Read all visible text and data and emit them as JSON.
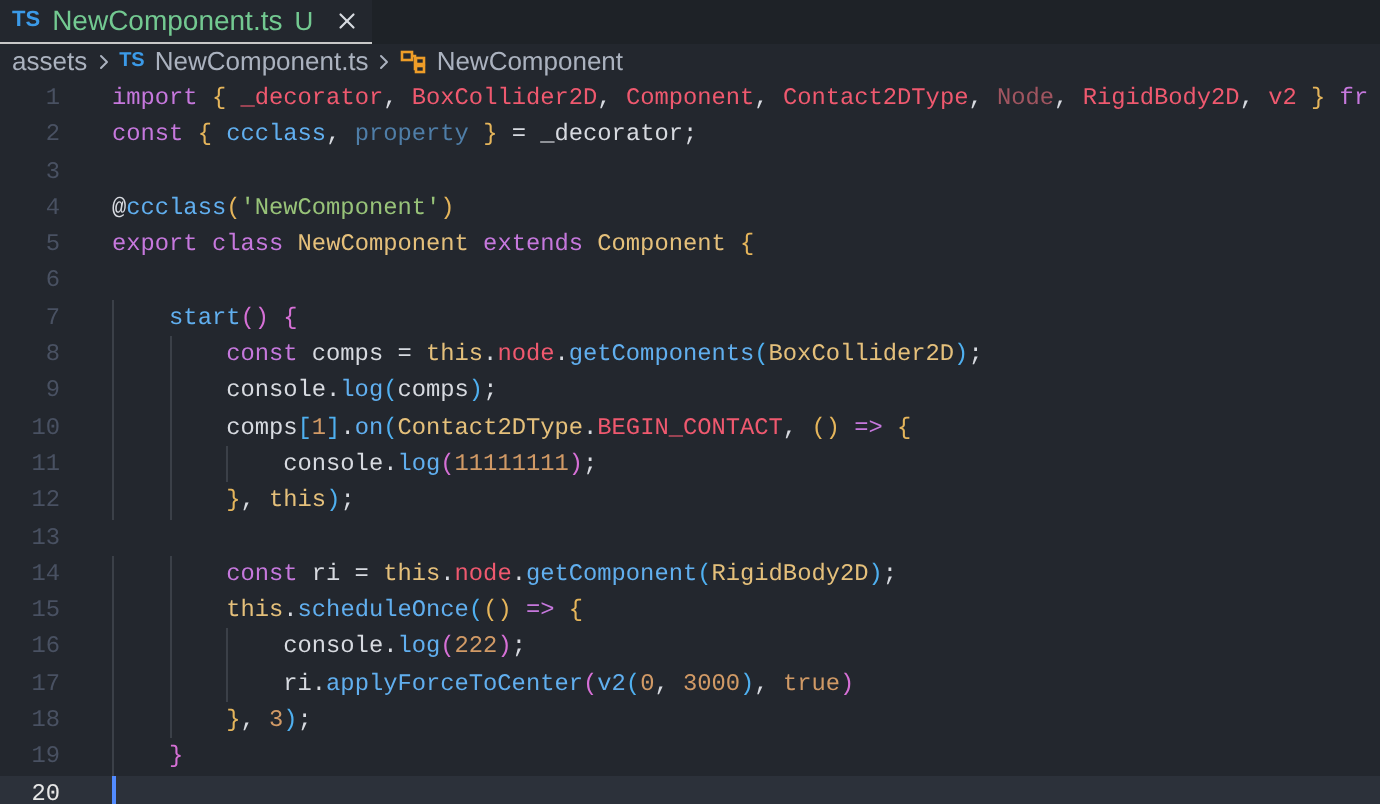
{
  "tabs": [
    {
      "icon_text": "TS",
      "label": "NewComponent.ts",
      "status": "U",
      "selected": true
    }
  ],
  "breadcrumb": {
    "folder": "assets",
    "file_icon_text": "TS",
    "file": "NewComponent.ts",
    "symbol": "NewComponent"
  },
  "lines": [
    {
      "number": "1",
      "active": false,
      "tokens": [
        {
          "kind": "keyword",
          "text": "import"
        },
        {
          "kind": "bracket1",
          "text": " {"
        },
        {
          "kind": "type",
          "text": " _decorator"
        },
        {
          "kind": "plain",
          "text": ", "
        },
        {
          "kind": "type",
          "text": "BoxCollider2D"
        },
        {
          "kind": "plain",
          "text": ", "
        },
        {
          "kind": "type",
          "text": "Component"
        },
        {
          "kind": "plain",
          "text": ", "
        },
        {
          "kind": "type",
          "text": "Contact2DType"
        },
        {
          "kind": "plain",
          "text": ", "
        },
        {
          "kind": "faded_type",
          "text": "Node"
        },
        {
          "kind": "plain",
          "text": ", "
        },
        {
          "kind": "type",
          "text": "RigidBody2D"
        },
        {
          "kind": "plain",
          "text": ", "
        },
        {
          "kind": "type",
          "text": "v2"
        },
        {
          "kind": "bracket1",
          "text": " }"
        },
        {
          "kind": "keyword",
          "text": " fr"
        }
      ]
    },
    {
      "number": "2",
      "active": false,
      "tokens": [
        {
          "kind": "keyword",
          "text": "const"
        },
        {
          "kind": "bracket1",
          "text": " {"
        },
        {
          "kind": "function",
          "text": " ccclass"
        },
        {
          "kind": "plain",
          "text": ", "
        },
        {
          "kind": "faded_function",
          "text": "property"
        },
        {
          "kind": "bracket1",
          "text": " }"
        },
        {
          "kind": "plain",
          "text": " = _decorator;"
        }
      ]
    },
    {
      "number": "3",
      "active": false
    },
    {
      "number": "4",
      "active": false,
      "tokens": [
        {
          "kind": "plain",
          "text": "@"
        },
        {
          "kind": "function",
          "text": "ccclass"
        },
        {
          "kind": "bracket1",
          "text": "("
        },
        {
          "kind": "string",
          "text": "'NewComponent'"
        },
        {
          "kind": "bracket1",
          "text": ")"
        }
      ]
    },
    {
      "number": "5",
      "active": false,
      "tokens": [
        {
          "kind": "keyword",
          "text": "export"
        },
        {
          "kind": "keyword",
          "text": " class"
        },
        {
          "kind": "class",
          "text": " NewComponent"
        },
        {
          "kind": "keyword",
          "text": " extends"
        },
        {
          "kind": "class",
          "text": " Component"
        },
        {
          "kind": "bracket1",
          "text": " {"
        }
      ]
    },
    {
      "number": "6",
      "active": false
    },
    {
      "number": "7",
      "active": false,
      "tokens": [
        {
          "kind": "function",
          "text": "    start"
        },
        {
          "kind": "bracket2",
          "text": "()"
        },
        {
          "kind": "bracket2",
          "text": " {"
        }
      ]
    },
    {
      "number": "8",
      "active": false,
      "tokens": [
        {
          "kind": "keyword",
          "text": "        const"
        },
        {
          "kind": "plain",
          "text": " comps = "
        },
        {
          "kind": "class",
          "text": "this"
        },
        {
          "kind": "plain",
          "text": "."
        },
        {
          "kind": "type",
          "text": "node"
        },
        {
          "kind": "plain",
          "text": "."
        },
        {
          "kind": "function",
          "text": "getComponents"
        },
        {
          "kind": "bracket3",
          "text": "("
        },
        {
          "kind": "class",
          "text": "BoxCollider2D"
        },
        {
          "kind": "bracket3",
          "text": ")"
        },
        {
          "kind": "plain",
          "text": ";"
        }
      ]
    },
    {
      "number": "9",
      "active": false,
      "tokens": [
        {
          "kind": "plain",
          "text": "        console."
        },
        {
          "kind": "function",
          "text": "log"
        },
        {
          "kind": "bracket3",
          "text": "("
        },
        {
          "kind": "plain",
          "text": "comps"
        },
        {
          "kind": "bracket3",
          "text": ")"
        },
        {
          "kind": "plain",
          "text": ";"
        }
      ]
    },
    {
      "number": "10",
      "active": false,
      "tokens": [
        {
          "kind": "plain",
          "text": "        comps"
        },
        {
          "kind": "bracket3",
          "text": "["
        },
        {
          "kind": "number",
          "text": "1"
        },
        {
          "kind": "bracket3",
          "text": "]"
        },
        {
          "kind": "plain",
          "text": "."
        },
        {
          "kind": "function",
          "text": "on"
        },
        {
          "kind": "bracket3",
          "text": "("
        },
        {
          "kind": "class",
          "text": "Contact2DType"
        },
        {
          "kind": "plain",
          "text": "."
        },
        {
          "kind": "type",
          "text": "BEGIN_CONTACT"
        },
        {
          "kind": "plain",
          "text": ", "
        },
        {
          "kind": "bracket1",
          "text": "()"
        },
        {
          "kind": "keyword",
          "text": " =>"
        },
        {
          "kind": "bracket1",
          "text": " {"
        }
      ]
    },
    {
      "number": "11",
      "active": false,
      "tokens": [
        {
          "kind": "plain",
          "text": "            console."
        },
        {
          "kind": "function",
          "text": "log"
        },
        {
          "kind": "bracket2",
          "text": "("
        },
        {
          "kind": "number",
          "text": "11111111"
        },
        {
          "kind": "bracket2",
          "text": ")"
        },
        {
          "kind": "plain",
          "text": ";"
        }
      ]
    },
    {
      "number": "12",
      "active": false,
      "tokens": [
        {
          "kind": "bracket1",
          "text": "        }"
        },
        {
          "kind": "plain",
          "text": ", "
        },
        {
          "kind": "class",
          "text": "this"
        },
        {
          "kind": "bracket3",
          "text": ")"
        },
        {
          "kind": "plain",
          "text": ";"
        }
      ]
    },
    {
      "number": "13",
      "active": false
    },
    {
      "number": "14",
      "active": false,
      "tokens": [
        {
          "kind": "keyword",
          "text": "        const"
        },
        {
          "kind": "plain",
          "text": " ri = "
        },
        {
          "kind": "class",
          "text": "this"
        },
        {
          "kind": "plain",
          "text": "."
        },
        {
          "kind": "type",
          "text": "node"
        },
        {
          "kind": "plain",
          "text": "."
        },
        {
          "kind": "function",
          "text": "getComponent"
        },
        {
          "kind": "bracket3",
          "text": "("
        },
        {
          "kind": "class",
          "text": "RigidBody2D"
        },
        {
          "kind": "bracket3",
          "text": ")"
        },
        {
          "kind": "plain",
          "text": ";"
        }
      ]
    },
    {
      "number": "15",
      "active": false,
      "tokens": [
        {
          "kind": "class",
          "text": "        this"
        },
        {
          "kind": "plain",
          "text": "."
        },
        {
          "kind": "function",
          "text": "scheduleOnce"
        },
        {
          "kind": "bracket3",
          "text": "("
        },
        {
          "kind": "bracket1",
          "text": "()"
        },
        {
          "kind": "keyword",
          "text": " =>"
        },
        {
          "kind": "bracket1",
          "text": " {"
        }
      ]
    },
    {
      "number": "16",
      "active": false,
      "tokens": [
        {
          "kind": "plain",
          "text": "            console."
        },
        {
          "kind": "function",
          "text": "log"
        },
        {
          "kind": "bracket2",
          "text": "("
        },
        {
          "kind": "number",
          "text": "222"
        },
        {
          "kind": "bracket2",
          "text": ")"
        },
        {
          "kind": "plain",
          "text": ";"
        }
      ]
    },
    {
      "number": "17",
      "active": false,
      "tokens": [
        {
          "kind": "plain",
          "text": "            ri."
        },
        {
          "kind": "function",
          "text": "applyForceToCenter"
        },
        {
          "kind": "bracket2",
          "text": "("
        },
        {
          "kind": "function",
          "text": "v2"
        },
        {
          "kind": "bracket3",
          "text": "("
        },
        {
          "kind": "number",
          "text": "0"
        },
        {
          "kind": "plain",
          "text": ", "
        },
        {
          "kind": "number",
          "text": "3000"
        },
        {
          "kind": "bracket3",
          "text": ")"
        },
        {
          "kind": "plain",
          "text": ", "
        },
        {
          "kind": "number",
          "text": "true"
        },
        {
          "kind": "bracket2",
          "text": ")"
        }
      ]
    },
    {
      "number": "18",
      "active": false,
      "tokens": [
        {
          "kind": "bracket1",
          "text": "        }"
        },
        {
          "kind": "plain",
          "text": ", "
        },
        {
          "kind": "number",
          "text": "3"
        },
        {
          "kind": "bracket3",
          "text": ")"
        },
        {
          "kind": "plain",
          "text": ";"
        }
      ]
    },
    {
      "number": "19",
      "active": false,
      "tokens": [
        {
          "kind": "bracket2",
          "text": "    }"
        }
      ]
    },
    {
      "number": "20",
      "active": true
    }
  ]
}
